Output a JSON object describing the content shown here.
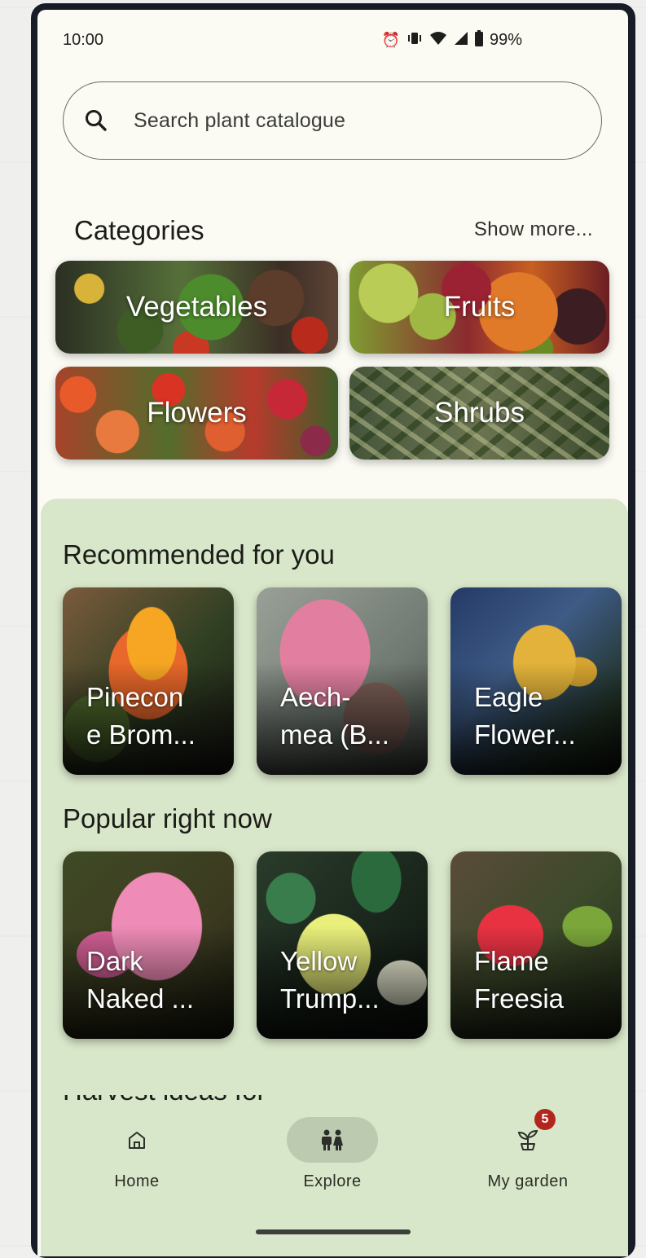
{
  "status_bar": {
    "time": "10:00",
    "battery": "99%",
    "icons": [
      "alarm-icon",
      "vibrate-icon",
      "wifi-icon",
      "signal-icon",
      "battery-icon"
    ]
  },
  "search": {
    "placeholder": "Search plant catalogue"
  },
  "categories": {
    "title": "Categories",
    "show_more": "Show more...",
    "items": [
      {
        "label": "Vegetables"
      },
      {
        "label": "Fruits"
      },
      {
        "label": "Flowers"
      },
      {
        "label": "Shrubs"
      }
    ]
  },
  "recommended": {
    "title": "Recommended for you",
    "items": [
      {
        "name": "Pinecon\ne Brom..."
      },
      {
        "name": "Aech-\nmea (B..."
      },
      {
        "name": "Eagle\nFlower..."
      }
    ]
  },
  "popular": {
    "title": "Popular right now",
    "items": [
      {
        "name": "Dark\nNaked ..."
      },
      {
        "name": "Yellow\nTrump..."
      },
      {
        "name": "Flame\nFreesia"
      }
    ]
  },
  "next_section_partial": "Harvest ideas for this season",
  "nav": {
    "items": [
      {
        "label": "Home",
        "icon": "home-icon",
        "active": false
      },
      {
        "label": "Explore",
        "icon": "explore-icon",
        "active": true
      },
      {
        "label": "My garden",
        "icon": "sprout-icon",
        "active": false,
        "badge": "5"
      }
    ]
  },
  "colors": {
    "background": "#fbfbf4",
    "panel": "#d8e6c9",
    "active_nav_pill": "#bccbb0",
    "badge": "#b3261e"
  }
}
